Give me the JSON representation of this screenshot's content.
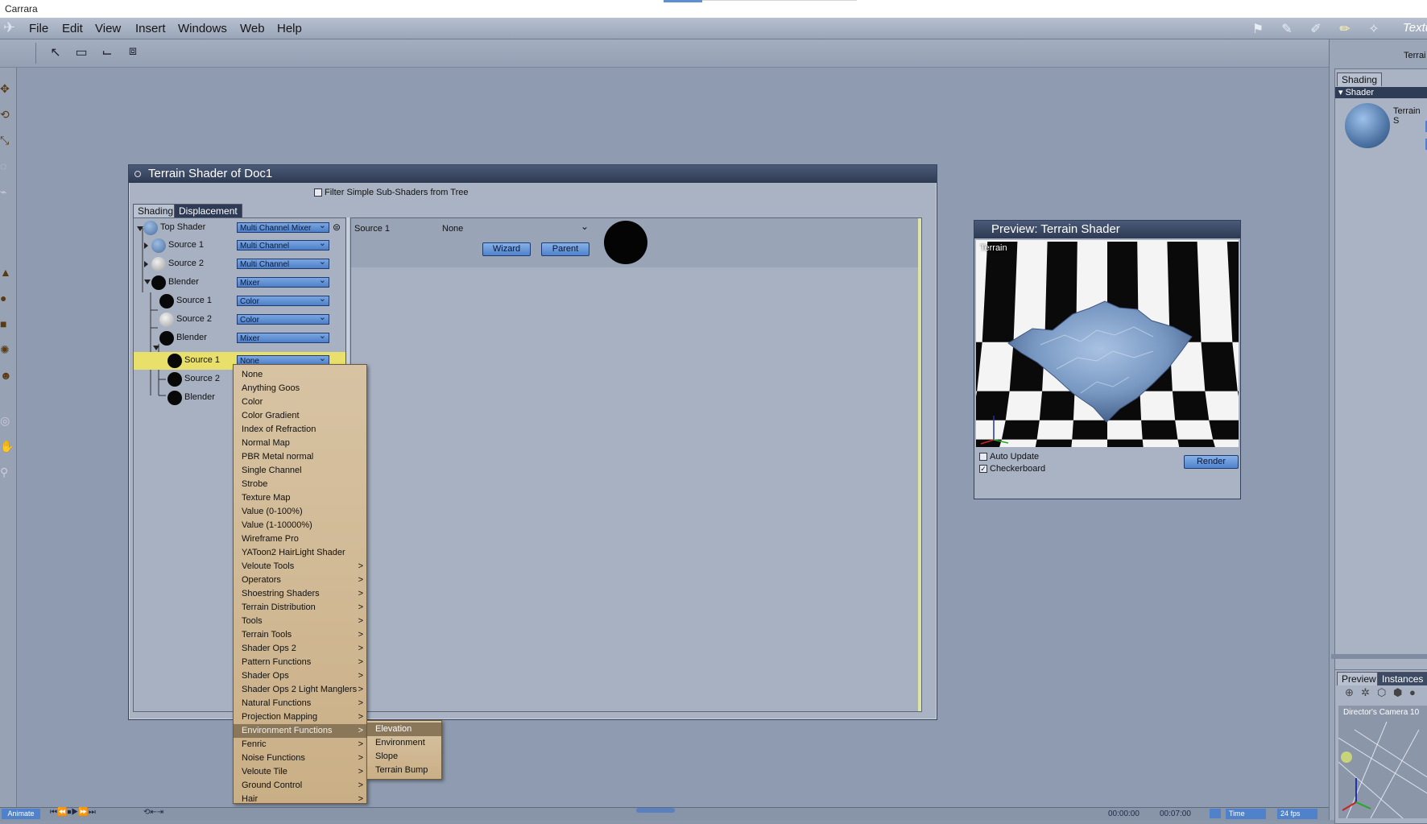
{
  "app": {
    "title": "Carrara"
  },
  "menubar": {
    "items": [
      "File",
      "Edit",
      "View",
      "Insert",
      "Windows",
      "Web",
      "Help"
    ],
    "right_label": "Textu"
  },
  "right_panel": {
    "top_label": "Terrai",
    "tab_shading": "Shading",
    "section_shader": "Shader",
    "terrain_label": "Terrain S",
    "tab_preview": "Preview",
    "tab_instances": "Instances",
    "camera_label": "Director's Camera 10"
  },
  "shader_window": {
    "title": "Terrain Shader of Doc1",
    "filter_label": "Filter Simple Sub-Shaders from Tree",
    "tabs": [
      "Shading",
      "Displacement"
    ],
    "tree": [
      {
        "label": "Top Shader",
        "value": "Multi Channel Mixer"
      },
      {
        "label": "Source 1",
        "value": "Multi Channel"
      },
      {
        "label": "Source 2",
        "value": "Multi Channel"
      },
      {
        "label": "Blender",
        "value": "Mixer"
      },
      {
        "label": "Source 1",
        "value": "Color"
      },
      {
        "label": "Source 2",
        "value": "Color"
      },
      {
        "label": "Blender",
        "value": "Mixer"
      },
      {
        "label": "Source 1",
        "value": "None"
      },
      {
        "label": "Source 2",
        "value": ""
      },
      {
        "label": "Blender",
        "value": ""
      }
    ],
    "detail": {
      "label": "Source 1",
      "value": "None",
      "wizard": "Wizard",
      "parent": "Parent"
    }
  },
  "dropdown_menu": {
    "items": [
      {
        "label": "None",
        "sub": false
      },
      {
        "label": "Anything Goos",
        "sub": false
      },
      {
        "label": "Color",
        "sub": false
      },
      {
        "label": "Color Gradient",
        "sub": false
      },
      {
        "label": "Index of Refraction",
        "sub": false
      },
      {
        "label": "Normal Map",
        "sub": false
      },
      {
        "label": "PBR Metal normal",
        "sub": false
      },
      {
        "label": "Single Channel",
        "sub": false
      },
      {
        "label": "Strobe",
        "sub": false
      },
      {
        "label": "Texture Map",
        "sub": false
      },
      {
        "label": "Value (0-100%)",
        "sub": false
      },
      {
        "label": "Value (1-10000%)",
        "sub": false
      },
      {
        "label": "Wireframe Pro",
        "sub": false
      },
      {
        "label": "YAToon2 HairLight Shader",
        "sub": false
      },
      {
        "label": "Veloute Tools",
        "sub": true
      },
      {
        "label": "Operators",
        "sub": true
      },
      {
        "label": "Shoestring Shaders",
        "sub": true
      },
      {
        "label": "Terrain Distribution",
        "sub": true
      },
      {
        "label": "Tools",
        "sub": true
      },
      {
        "label": "Terrain Tools",
        "sub": true
      },
      {
        "label": "Shader Ops 2",
        "sub": true
      },
      {
        "label": "Pattern Functions",
        "sub": true
      },
      {
        "label": "Shader Ops",
        "sub": true
      },
      {
        "label": "Shader Ops 2 Light Manglers",
        "sub": true
      },
      {
        "label": "Natural Functions",
        "sub": true
      },
      {
        "label": "Projection Mapping",
        "sub": true
      },
      {
        "label": "Environment Functions",
        "sub": true
      },
      {
        "label": "Fenric",
        "sub": true
      },
      {
        "label": "Noise Functions",
        "sub": true
      },
      {
        "label": "Veloute Tile",
        "sub": true
      },
      {
        "label": "Ground Control",
        "sub": true
      },
      {
        "label": "Hair",
        "sub": true
      }
    ],
    "selected": "Environment Functions",
    "submenu": [
      "Elevation",
      "Environment",
      "Slope",
      "Terrain Bump"
    ],
    "submenu_selected": "Elevation"
  },
  "preview": {
    "title": "Preview: Terrain Shader",
    "scene_label": "Terrain",
    "auto_update": "Auto Update",
    "checkerboard": "Checkerboard",
    "render": "Render"
  },
  "bottom": {
    "animate": "Animate",
    "time1": "00:00:00",
    "time2": "00:07:00",
    "time_label": "Time",
    "fps": "24 fps"
  }
}
